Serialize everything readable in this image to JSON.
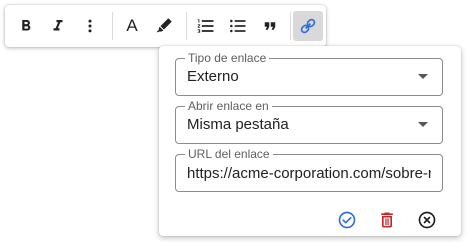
{
  "toolbar": {
    "buttons": [
      {
        "name": "bold",
        "icon": "bold-icon",
        "active": false
      },
      {
        "name": "italic",
        "icon": "italic-icon",
        "active": false
      },
      {
        "name": "more",
        "icon": "more-vertical-icon",
        "active": false
      },
      {
        "name": "text-color",
        "icon": "text-color-icon",
        "label": "A",
        "active": false
      },
      {
        "name": "highlight",
        "icon": "highlighter-icon",
        "active": false
      },
      {
        "name": "ordered-list",
        "icon": "ordered-list-icon",
        "active": false
      },
      {
        "name": "bullet-list",
        "icon": "bullet-list-icon",
        "active": false
      },
      {
        "name": "blockquote",
        "icon": "quote-icon",
        "active": false
      },
      {
        "name": "link",
        "icon": "link-icon",
        "active": true
      }
    ]
  },
  "link_popover": {
    "link_type": {
      "label": "Tipo de enlace",
      "value": "Externo"
    },
    "open_in": {
      "label": "Abrir enlace en",
      "value": "Misma pestaña"
    },
    "url": {
      "label": "URL del enlace",
      "value": "https://acme-corporation.com/sobre-nosotros"
    },
    "actions": [
      {
        "name": "confirm",
        "icon": "check-circle-icon"
      },
      {
        "name": "delete",
        "icon": "trash-icon"
      },
      {
        "name": "cancel",
        "icon": "close-circle-icon"
      }
    ]
  },
  "colors": {
    "accent": "#2f6fd6",
    "danger": "#c62828",
    "icon": "#222222",
    "active_bg": "#d9d9d9"
  }
}
